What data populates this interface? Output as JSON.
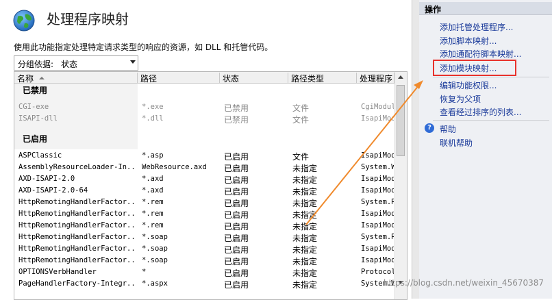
{
  "page": {
    "title": "处理程序映射",
    "description": "使用此功能指定处理特定请求类型的响应的资源，如 DLL 和托管代码。"
  },
  "group_by": {
    "label": "分组依据:",
    "value": "状态"
  },
  "table": {
    "columns": [
      "名称",
      "路径",
      "状态",
      "路径类型",
      "处理程序"
    ],
    "groups": [
      "已禁用",
      "已启用"
    ],
    "disabled_rows": [
      [
        "CGI-exe",
        "*.exe",
        "已禁用",
        "文件",
        "CgiModule"
      ],
      [
        "ISAPI-dll",
        "*.dll",
        "已禁用",
        "文件",
        "IsapiModule"
      ]
    ],
    "enabled_rows": [
      [
        "ASPClassic",
        "*.asp",
        "已启用",
        "文件",
        "IsapiModu"
      ],
      [
        "AssemblyResourceLoader-In...",
        "WebResource.axd",
        "已启用",
        "未指定",
        "System.We"
      ],
      [
        "AXD-ISAPI-2.0",
        "*.axd",
        "已启用",
        "未指定",
        "IsapiModu"
      ],
      [
        "AXD-ISAPI-2.0-64",
        "*.axd",
        "已启用",
        "未指定",
        "IsapiModu"
      ],
      [
        "HttpRemotingHandlerFactor...",
        "*.rem",
        "已启用",
        "未指定",
        "System.Ru"
      ],
      [
        "HttpRemotingHandlerFactor...",
        "*.rem",
        "已启用",
        "未指定",
        "IsapiModu"
      ],
      [
        "HttpRemotingHandlerFactor...",
        "*.rem",
        "已启用",
        "未指定",
        "IsapiModu"
      ],
      [
        "HttpRemotingHandlerFactor...",
        "*.soap",
        "已启用",
        "未指定",
        "System.Ru"
      ],
      [
        "HttpRemotingHandlerFactor...",
        "*.soap",
        "已启用",
        "未指定",
        "IsapiModu"
      ],
      [
        "HttpRemotingHandlerFactor...",
        "*.soap",
        "已启用",
        "未指定",
        "IsapiModu"
      ],
      [
        "OPTIONSVerbHandler",
        "*",
        "已启用",
        "未指定",
        "ProtocolS"
      ],
      [
        "PageHandlerFactory-Integr...",
        "*.aspx",
        "已启用",
        "未指定",
        "System.We"
      ]
    ]
  },
  "actions": {
    "title": "操作",
    "items": [
      "添加托管处理程序...",
      "添加脚本映射...",
      "添加通配符脚本映射...",
      "添加模块映射...",
      "编辑功能权限...",
      "恢复为父项",
      "查看经过排序的列表...",
      "帮助",
      "联机帮助"
    ]
  },
  "watermark": "https://blog.csdn.net/weixin_45670387",
  "colors": {
    "link": "#1a3a9a",
    "highlight": "#e8322c",
    "annotation_arrow": "#f08a2c"
  },
  "icons": {
    "header": "globe-icon",
    "help": "help-icon"
  }
}
